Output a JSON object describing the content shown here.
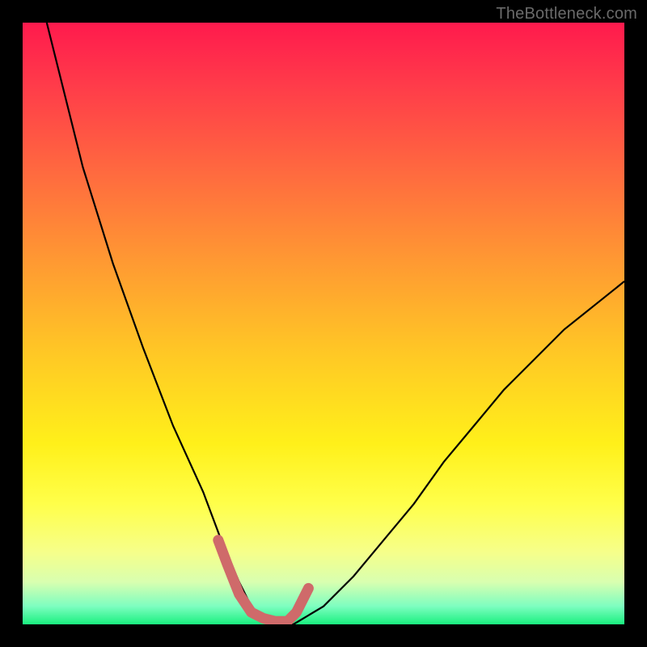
{
  "watermark": "TheBottleneck.com",
  "chart_data": {
    "type": "line",
    "title": "",
    "xlabel": "",
    "ylabel": "",
    "xlim": [
      0,
      100
    ],
    "ylim": [
      0,
      100
    ],
    "grid": false,
    "legend": false,
    "series": [
      {
        "name": "bottleneck-curve",
        "x": [
          4,
          10,
          15,
          20,
          25,
          30,
          33,
          36,
          38,
          40,
          42,
          45,
          50,
          55,
          60,
          65,
          70,
          75,
          80,
          85,
          90,
          95,
          100
        ],
        "values": [
          100,
          76,
          60,
          46,
          33,
          22,
          14,
          7,
          3,
          1,
          0,
          0,
          3,
          8,
          14,
          20,
          27,
          33,
          39,
          44,
          49,
          53,
          57
        ]
      },
      {
        "name": "highlight-segment",
        "x": [
          32.5,
          34,
          36,
          38,
          40,
          42,
          44,
          45.5,
          47.5
        ],
        "values": [
          14,
          10,
          5,
          2,
          1,
          0.5,
          0.5,
          2,
          6
        ]
      }
    ],
    "colors": {
      "curve": "#000000",
      "highlight": "#cf6a6a",
      "background_top": "#ff1a4d",
      "background_bottom": "#1af07f"
    }
  }
}
